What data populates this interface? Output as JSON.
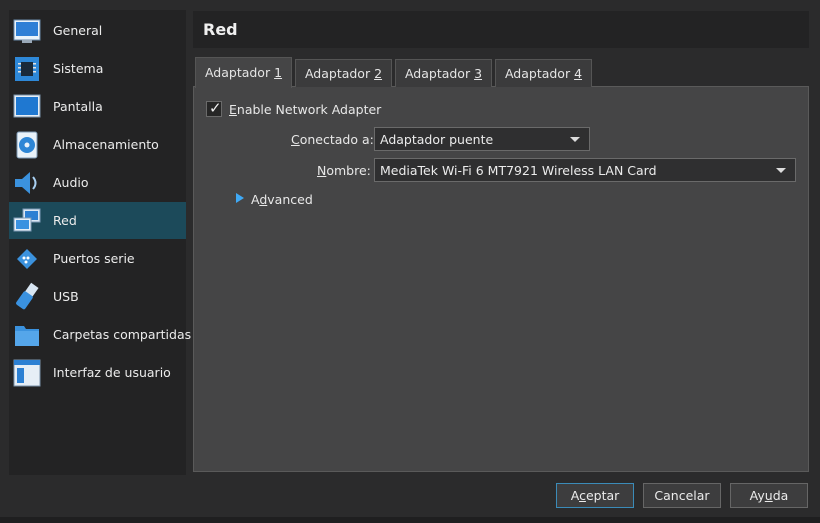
{
  "sidebar": {
    "items": [
      {
        "label": "General",
        "icon": "general-monitor-icon"
      },
      {
        "label": "Sistema",
        "icon": "chip-icon"
      },
      {
        "label": "Pantalla",
        "icon": "display-icon"
      },
      {
        "label": "Almacenamiento",
        "icon": "storage-disc-icon"
      },
      {
        "label": "Audio",
        "icon": "speaker-icon"
      },
      {
        "label": "Red",
        "icon": "network-icon"
      },
      {
        "label": "Puertos serie",
        "icon": "serial-port-icon"
      },
      {
        "label": "USB",
        "icon": "usb-icon"
      },
      {
        "label": "Carpetas compartidas",
        "icon": "folder-icon"
      },
      {
        "label": "Interfaz de usuario",
        "icon": "ui-window-icon"
      }
    ],
    "active": "Red"
  },
  "header": {
    "title": "Red"
  },
  "tabs": [
    {
      "prefix": "Adaptador ",
      "mnemonic": "1"
    },
    {
      "prefix": "Adaptador ",
      "mnemonic": "2"
    },
    {
      "prefix": "Adaptador ",
      "mnemonic": "3"
    },
    {
      "prefix": "Adaptador ",
      "mnemonic": "4"
    }
  ],
  "adapter": {
    "enable": {
      "mnemonic": "E",
      "rest": "nable Network Adapter",
      "checked": true
    },
    "connected": {
      "mnemonic": "C",
      "rest": "onectado a:",
      "value": "Adaptador puente"
    },
    "name": {
      "mnemonic": "N",
      "rest": "ombre:",
      "value": "MediaTek Wi-Fi 6 MT7921 Wireless LAN Card"
    },
    "advanced": {
      "first": "A",
      "mnemonic": "d",
      "rest": "vanced"
    }
  },
  "footer": {
    "accept": {
      "pre": "A",
      "mnemonic": "c",
      "post": "eptar"
    },
    "cancel": {
      "pre": "",
      "mnemonic": "",
      "post": "Cancelar"
    },
    "help": {
      "pre": "Ay",
      "mnemonic": "u",
      "post": "da"
    }
  },
  "colors": {
    "accent": "#3fa9f5",
    "active_row": "#1c4a5a",
    "panel": "#454546"
  }
}
